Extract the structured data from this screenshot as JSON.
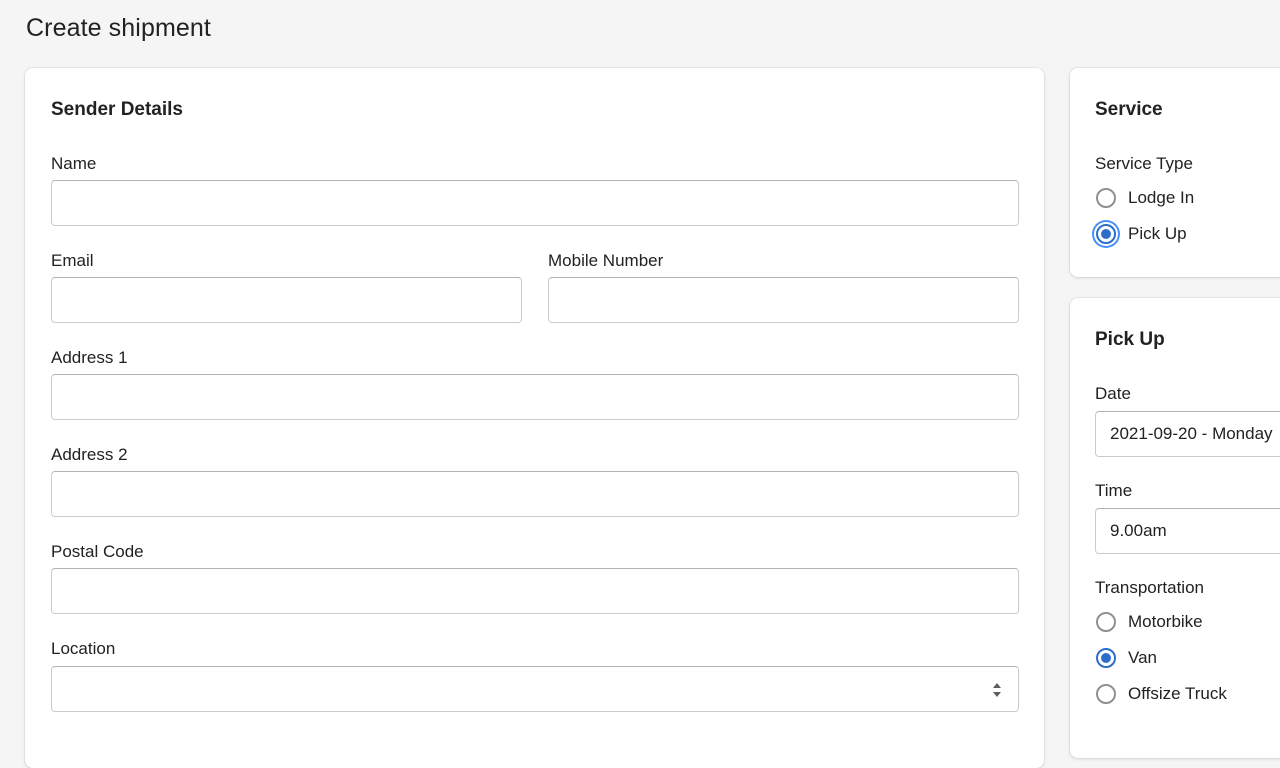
{
  "page": {
    "title": "Create shipment"
  },
  "sender": {
    "title": "Sender Details",
    "fields": {
      "name": {
        "label": "Name",
        "value": ""
      },
      "email": {
        "label": "Email",
        "value": ""
      },
      "mobile": {
        "label": "Mobile Number",
        "value": ""
      },
      "address1": {
        "label": "Address 1",
        "value": ""
      },
      "address2": {
        "label": "Address 2",
        "value": ""
      },
      "postal": {
        "label": "Postal Code",
        "value": ""
      },
      "location": {
        "label": "Location",
        "value": ""
      }
    }
  },
  "service": {
    "title": "Service",
    "type_label": "Service Type",
    "options": [
      {
        "label": "Lodge In",
        "checked": false
      },
      {
        "label": "Pick Up",
        "checked": true
      }
    ]
  },
  "pickup": {
    "title": "Pick Up",
    "date": {
      "label": "Date",
      "value": "2021-09-20 - Monday"
    },
    "time": {
      "label": "Time",
      "value": "9.00am"
    },
    "transportation": {
      "label": "Transportation",
      "options": [
        {
          "label": "Motorbike",
          "checked": false
        },
        {
          "label": "Van",
          "checked": true
        },
        {
          "label": "Offsize Truck",
          "checked": false
        }
      ]
    }
  },
  "colors": {
    "accent": "#2c6ecb",
    "background": "#f5f5f5",
    "card": "#ffffff",
    "border": "#c9cccf"
  }
}
